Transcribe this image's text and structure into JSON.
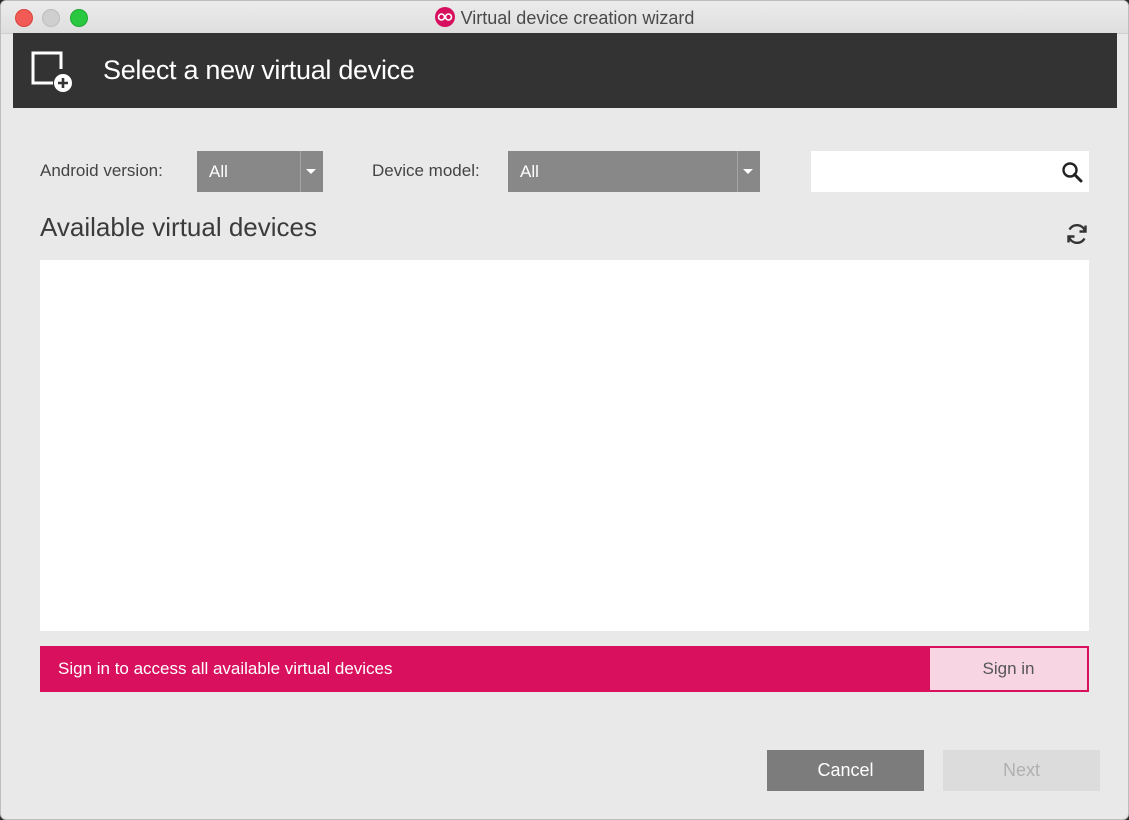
{
  "window": {
    "title": "Virtual device creation wizard"
  },
  "header": {
    "title": "Select a new virtual device"
  },
  "filters": {
    "android_version_label": "Android version:",
    "android_version_value": "All",
    "device_model_label": "Device model:",
    "device_model_value": "All",
    "search_value": ""
  },
  "list": {
    "title": "Available virtual devices"
  },
  "signin": {
    "message": "Sign in to access all available virtual devices",
    "button_label": "Sign in"
  },
  "footer": {
    "cancel_label": "Cancel",
    "next_label": "Next"
  },
  "colors": {
    "accent": "#d8105e",
    "header_bg": "#333333",
    "dropdown_bg": "#888888"
  },
  "icons": [
    "add-device-icon",
    "search-icon",
    "refresh-icon",
    "app-logo-icon"
  ]
}
